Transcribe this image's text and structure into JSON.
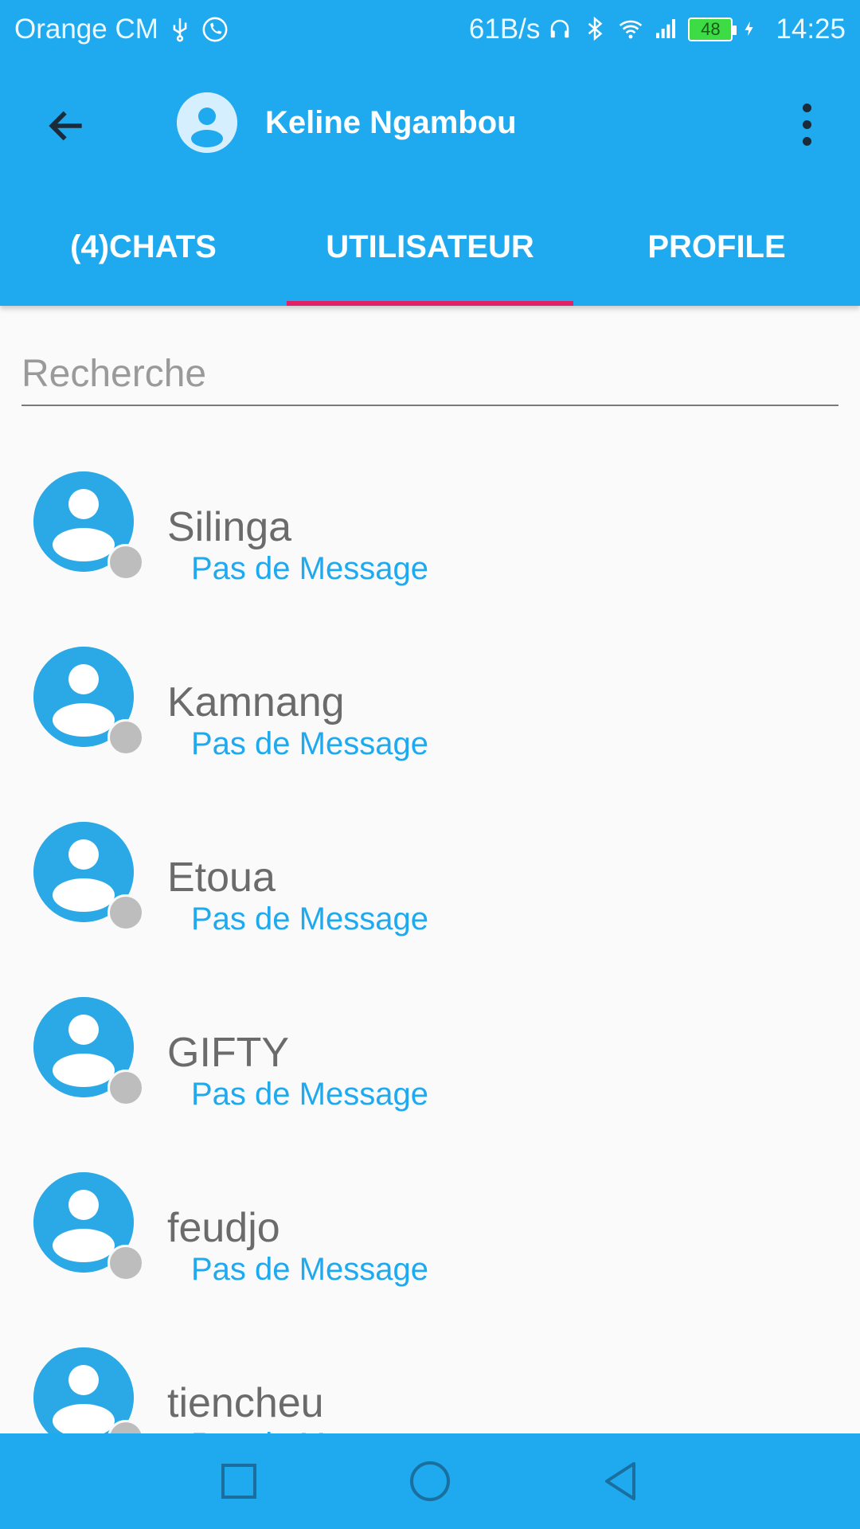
{
  "status_bar": {
    "carrier": "Orange CM",
    "net_speed": "61B/s",
    "battery": "48",
    "time": "14:25"
  },
  "toolbar": {
    "title": "Keline Ngambou"
  },
  "tabs": [
    {
      "label": "(4)CHATS",
      "selected": false
    },
    {
      "label": "UTILISATEUR",
      "selected": true
    },
    {
      "label": "PROFILE",
      "selected": false
    }
  ],
  "search": {
    "placeholder": "Recherche",
    "value": ""
  },
  "users": [
    {
      "name": "Silinga",
      "last_message": "Pas de Message"
    },
    {
      "name": "Kamnang",
      "last_message": "Pas de Message"
    },
    {
      "name": "Etoua",
      "last_message": "Pas de Message"
    },
    {
      "name": "GIFTY",
      "last_message": "Pas de Message"
    },
    {
      "name": "feudjo",
      "last_message": "Pas de Message"
    },
    {
      "name": "tiencheu",
      "last_message": "Pas de Message"
    }
  ],
  "colors": {
    "primary": "#1fa9ee",
    "accent": "#e0216a",
    "offline_dot": "#bdbdbd"
  },
  "icons": {
    "back": "arrow-left-icon",
    "menu": "more-vert-icon",
    "avatar": "person-icon",
    "nav_recents": "square-icon",
    "nav_home": "circle-icon",
    "nav_back": "triangle-back-icon"
  }
}
